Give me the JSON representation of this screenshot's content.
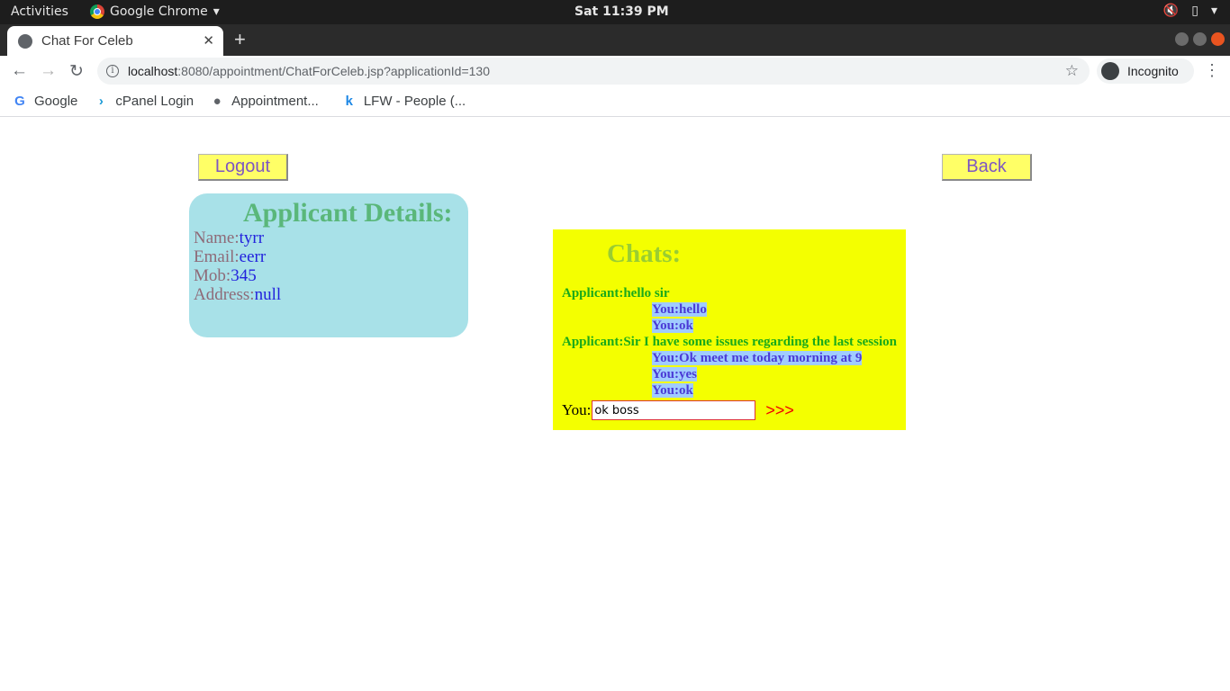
{
  "system_bar": {
    "activities": "Activities",
    "app_name": "Google Chrome",
    "clock": "Sat 11:39 PM",
    "tray_icons": [
      "volume-muted-icon",
      "battery-icon",
      "power-menu-icon"
    ]
  },
  "browser": {
    "tab_title": "Chat For Celeb",
    "url_host": "localhost",
    "url_rest": ":8080/appointment/ChatForCeleb.jsp?applicationId=130",
    "profile": "Incognito",
    "bookmarks": [
      {
        "icon": "google-icon",
        "label": "Google"
      },
      {
        "icon": "cpanel-icon",
        "label": "cPanel Login"
      },
      {
        "icon": "globe-icon",
        "label": "Appointment..."
      },
      {
        "icon": "k-icon",
        "label": "LFW - People (..."
      }
    ]
  },
  "page": {
    "logout_label": "Logout",
    "back_label": "Back",
    "details": {
      "title": "Applicant Details:",
      "name_key": "Name:",
      "name_val": "tyrr",
      "email_key": "Email:",
      "email_val": "eerr",
      "mob_key": "Mob:",
      "mob_val": "345",
      "address_key": "Address:",
      "address_val": "null"
    },
    "chats": {
      "title": "Chats:",
      "messages": [
        {
          "from": "applicant",
          "text": "Applicant:hello sir"
        },
        {
          "from": "you",
          "text": "You:hello"
        },
        {
          "from": "you",
          "text": "You:ok"
        },
        {
          "from": "applicant",
          "text": "Applicant:Sir I have some issues regarding the last session"
        },
        {
          "from": "you",
          "text": "You:Ok meet me today morning at 9"
        },
        {
          "from": "you",
          "text": "You:yes"
        },
        {
          "from": "you",
          "text": "You:ok"
        }
      ],
      "input_label": "You:",
      "input_value": "ok boss",
      "send_label": ">>>"
    }
  },
  "colors": {
    "button_bg": "#ffff66",
    "details_bg": "#a8e1e8",
    "chats_bg": "#f4ff00",
    "applicant_text": "#1aaa1a",
    "you_text": "#4b3bd6"
  }
}
